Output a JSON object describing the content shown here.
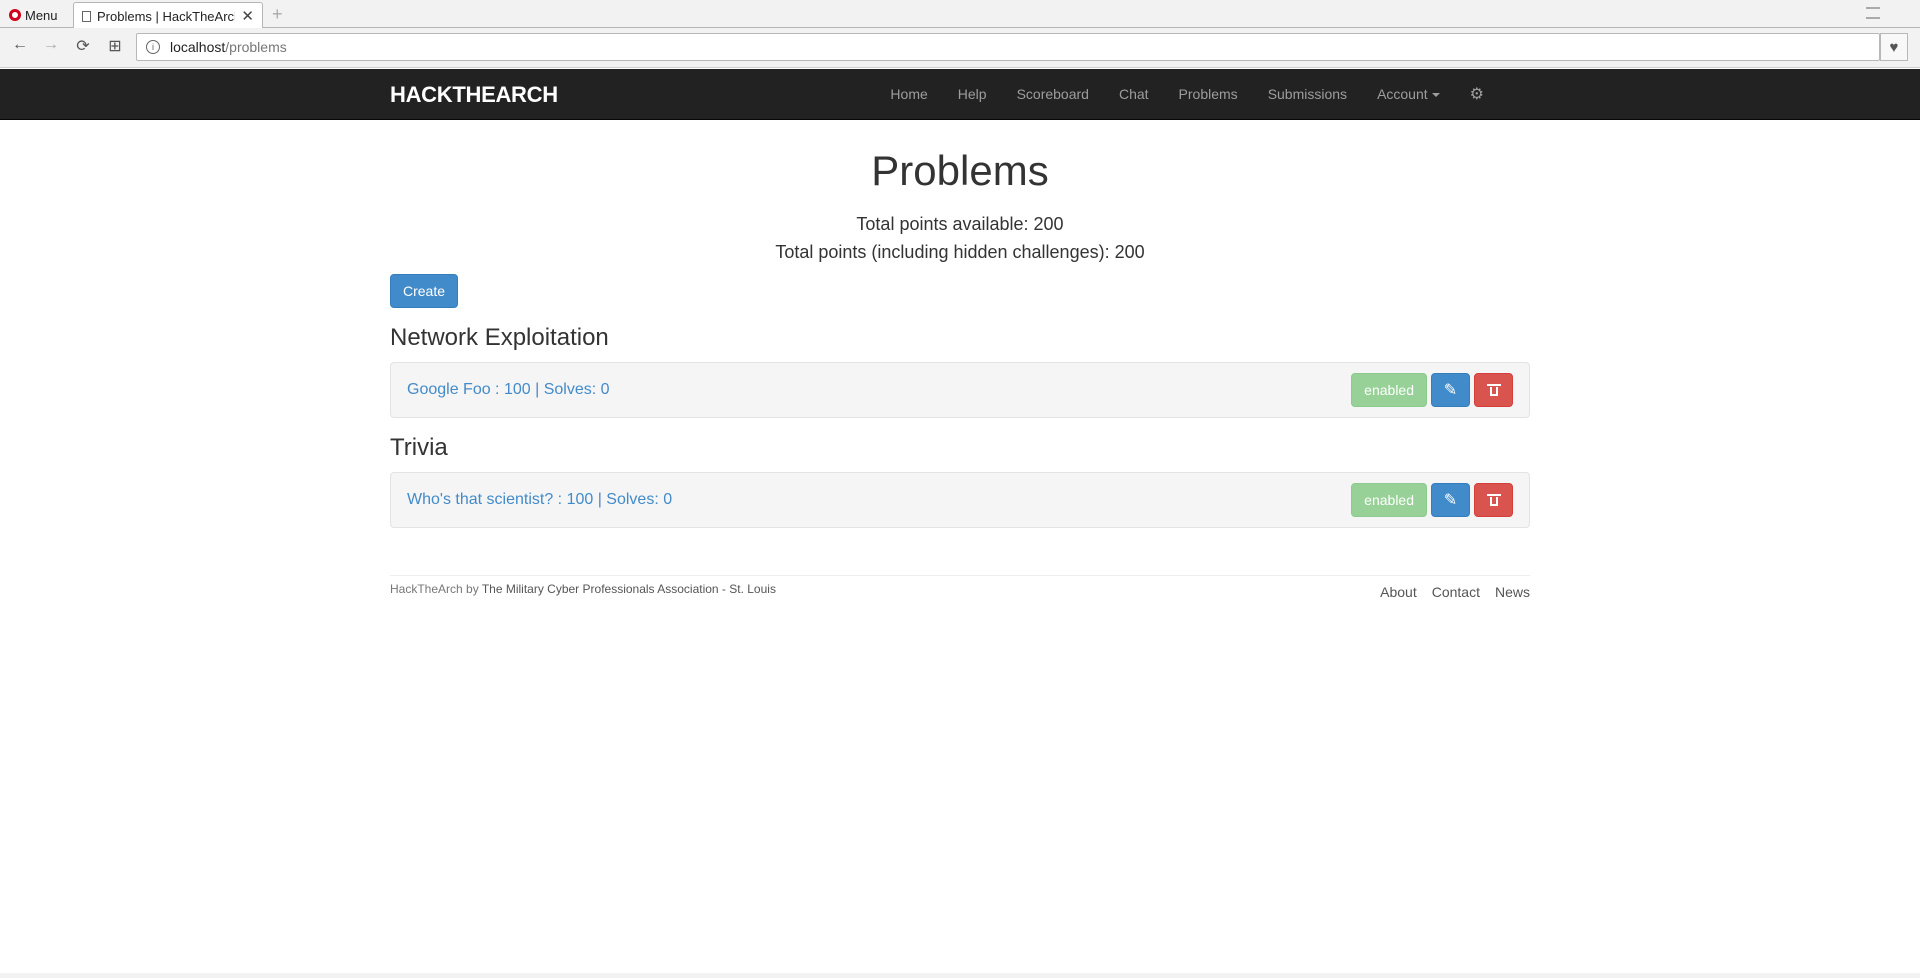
{
  "browser": {
    "menu_label": "Menu",
    "tab_title": "Problems | HackTheArch",
    "tab_close": "✕",
    "new_tab": "+",
    "url_host": "localhost",
    "url_path": "/problems",
    "back": "←",
    "forward": "→",
    "reload": "⟳",
    "speed_dial": "⊞",
    "bookmark": "♥"
  },
  "navbar": {
    "brand": "HACKTHEARCH",
    "links": [
      "Home",
      "Help",
      "Scoreboard",
      "Chat",
      "Problems",
      "Submissions"
    ],
    "account": "Account",
    "settings_icon": "⚙"
  },
  "page": {
    "title": "Problems",
    "total_points": "Total points available: 200",
    "total_points_hidden": "Total points (including hidden challenges): 200",
    "create_label": "Create"
  },
  "categories": [
    {
      "name": "Network Exploitation",
      "problems": [
        {
          "label": "Google Foo : 100 | Solves: 0",
          "status": "enabled"
        }
      ]
    },
    {
      "name": "Trivia",
      "problems": [
        {
          "label": "Who's that scientist? : 100 | Solves: 0",
          "status": "enabled"
        }
      ]
    }
  ],
  "footer": {
    "site": "HackTheArch",
    "by": " by ",
    "org": "The Military Cyber Professionals Association - St. Louis",
    "links": [
      "About",
      "Contact",
      "News"
    ]
  },
  "icons": {
    "edit": "✎",
    "colors": {
      "navbar": "#222222",
      "primary": "#428bca",
      "danger": "#d9534f",
      "success": "#93d093"
    }
  }
}
